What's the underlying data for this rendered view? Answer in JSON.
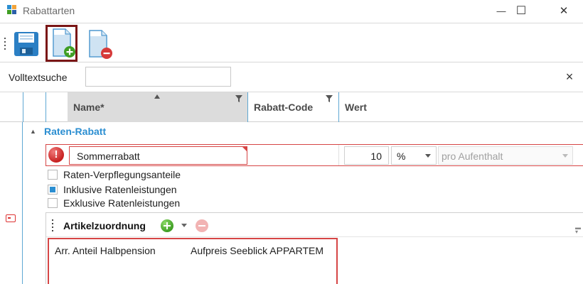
{
  "window": {
    "title": "Rabattarten",
    "controls": {
      "minimize": "—",
      "maximize": "☐",
      "close": "✕"
    }
  },
  "toolbar": {
    "buttons": [
      {
        "name": "save",
        "icon": "floppy-disk-icon"
      },
      {
        "name": "new",
        "icon": "document-add-icon",
        "selected": true
      },
      {
        "name": "delete",
        "icon": "document-remove-icon"
      }
    ]
  },
  "search": {
    "label": "Volltextsuche",
    "value": "",
    "placeholder": "",
    "clear_symbol": "×"
  },
  "grid": {
    "columns": [
      {
        "label": "Name*",
        "sorted": "ascending",
        "filter": true
      },
      {
        "label": "Rabatt-Code",
        "filter": true
      },
      {
        "label": "Wert"
      }
    ],
    "group": {
      "toggle": "▲",
      "title": "Raten-Rabatt"
    },
    "row": {
      "error_symbol": "!",
      "name": "Sommerrabatt",
      "code": "",
      "value": "10",
      "unit": "%",
      "period": "pro Aufenthalt"
    },
    "options": [
      {
        "label": "Raten-Verpflegungsanteile",
        "checked": false
      },
      {
        "label": "Inklusive Ratenleistungen",
        "checked": true
      },
      {
        "label": "Exklusive Ratenleistungen",
        "checked": false
      }
    ]
  },
  "article_assignment": {
    "title": "Artikelzuordnung",
    "items": [
      "Arr. Anteil Halbpension",
      "Aufpreis Seeblick APPARTEM"
    ]
  },
  "colors": {
    "accent": "#2b8ed1",
    "error": "#d64545",
    "selected_outline": "#7a1616",
    "add": "#3f9e24"
  }
}
